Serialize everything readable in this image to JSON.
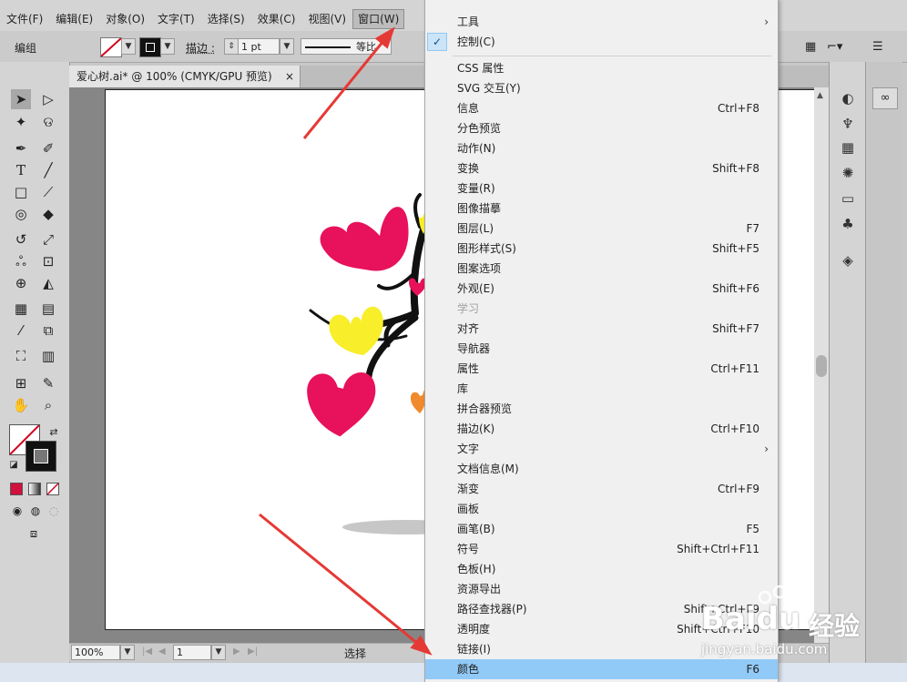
{
  "menubar": {
    "items": [
      "文件(F)",
      "编辑(E)",
      "对象(O)",
      "文字(T)",
      "选择(S)",
      "效果(C)",
      "视图(V)",
      "窗口(W)"
    ]
  },
  "controlbar": {
    "group_label": "编组",
    "stroke_label": "描边 :",
    "stroke_value": "1 pt",
    "profile_label": "等比"
  },
  "document": {
    "tab_title": "爱心树.ai* @ 100% (CMYK/GPU 预览)",
    "close_glyph": "×"
  },
  "statusbar": {
    "zoom": "100%",
    "page": "1",
    "status_text": "选择"
  },
  "dropdown": {
    "items": [
      {
        "label": "工具",
        "shortcut": "",
        "submenu": true
      },
      {
        "label": "控制(C)",
        "shortcut": "",
        "checked": true
      },
      {
        "label": "CSS 属性",
        "shortcut": ""
      },
      {
        "label": "SVG 交互(Y)",
        "shortcut": ""
      },
      {
        "label": "信息",
        "shortcut": "Ctrl+F8"
      },
      {
        "label": "分色预览",
        "shortcut": ""
      },
      {
        "label": "动作(N)",
        "shortcut": ""
      },
      {
        "label": "变换",
        "shortcut": "Shift+F8"
      },
      {
        "label": "变量(R)",
        "shortcut": ""
      },
      {
        "label": "图像描摹",
        "shortcut": ""
      },
      {
        "label": "图层(L)",
        "shortcut": "F7"
      },
      {
        "label": "图形样式(S)",
        "shortcut": "Shift+F5"
      },
      {
        "label": "图案选项",
        "shortcut": ""
      },
      {
        "label": "外观(E)",
        "shortcut": "Shift+F6"
      },
      {
        "label": "学习",
        "shortcut": "",
        "disabled": true
      },
      {
        "label": "对齐",
        "shortcut": "Shift+F7"
      },
      {
        "label": "导航器",
        "shortcut": ""
      },
      {
        "label": "属性",
        "shortcut": "Ctrl+F11"
      },
      {
        "label": "库",
        "shortcut": ""
      },
      {
        "label": "拼合器预览",
        "shortcut": ""
      },
      {
        "label": "描边(K)",
        "shortcut": "Ctrl+F10"
      },
      {
        "label": "文字",
        "shortcut": "",
        "submenu": true
      },
      {
        "label": "文档信息(M)",
        "shortcut": ""
      },
      {
        "label": "渐变",
        "shortcut": "Ctrl+F9"
      },
      {
        "label": "画板",
        "shortcut": ""
      },
      {
        "label": "画笔(B)",
        "shortcut": "F5"
      },
      {
        "label": "符号",
        "shortcut": "Shift+Ctrl+F11"
      },
      {
        "label": "色板(H)",
        "shortcut": ""
      },
      {
        "label": "资源导出",
        "shortcut": ""
      },
      {
        "label": "路径查找器(P)",
        "shortcut": "Shift+Ctrl+F9"
      },
      {
        "label": "透明度",
        "shortcut": "Shift+Ctrl+F10"
      },
      {
        "label": "链接(I)",
        "shortcut": ""
      },
      {
        "label": "颜色",
        "shortcut": "F6",
        "highlighted": true
      }
    ]
  },
  "watermark": {
    "brand": "Baidu",
    "brand_cn": "经验",
    "url": "jingyan.baidu.com"
  },
  "colors": {
    "heart_pink": "#e8115b",
    "heart_yellow": "#f8ee2a",
    "heart_orange": "#f08a2c",
    "menu_highlight": "#91c9f7",
    "arrow_red": "#e53935"
  }
}
